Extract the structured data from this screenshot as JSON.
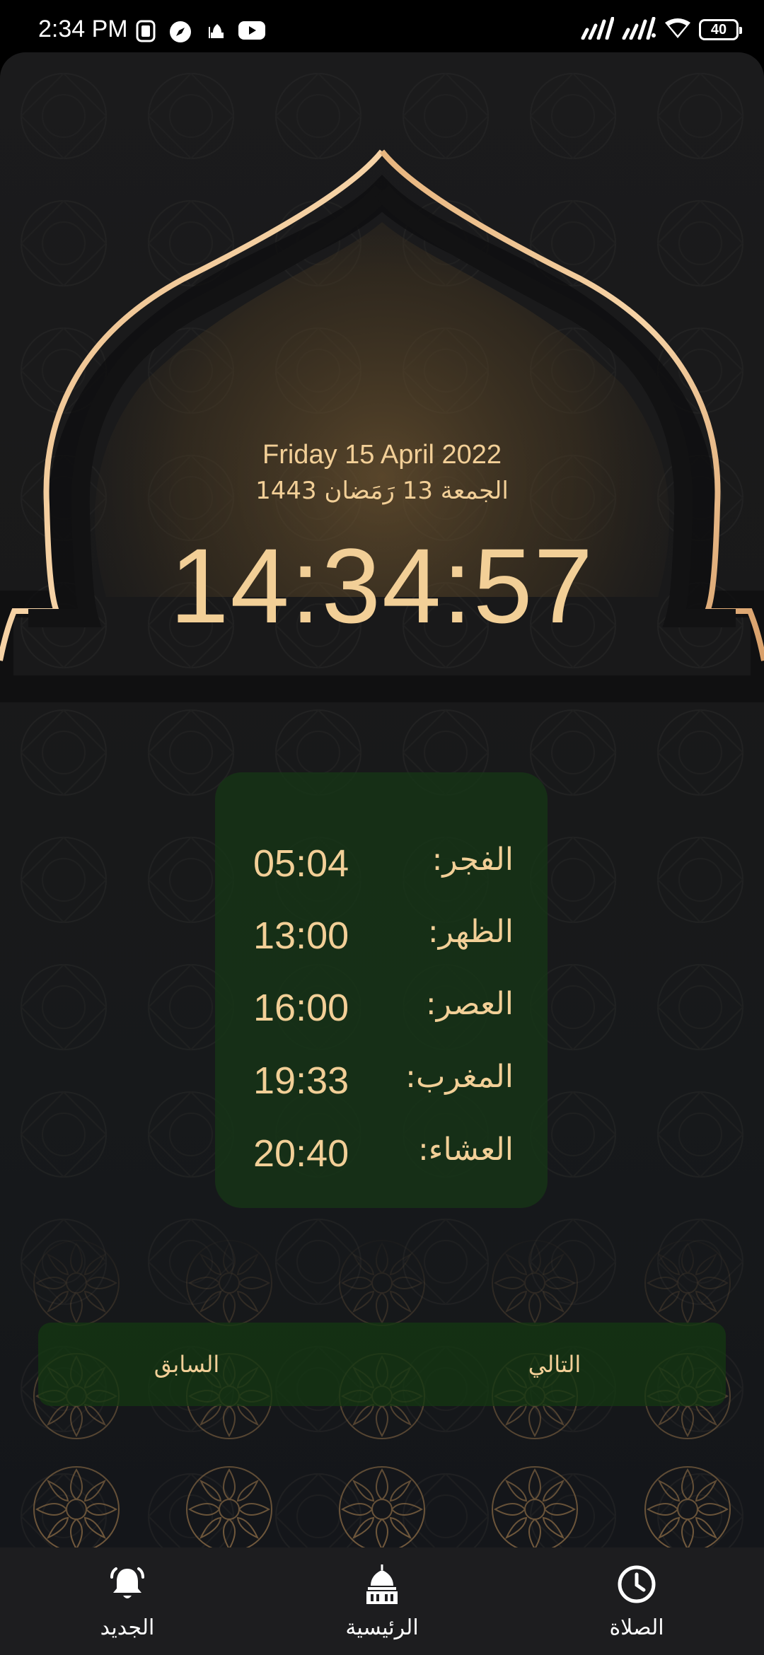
{
  "status_bar": {
    "time": "2:34 PM",
    "battery": "40",
    "icons": [
      "screen-record-icon",
      "compass-icon",
      "mosque-icon",
      "youtube-icon",
      "signal-icon",
      "signal-icon",
      "wifi-icon",
      "battery-icon"
    ]
  },
  "header": {
    "gregorian_date": "Friday 15 April 2022",
    "hijri_date": "الجمعة 13 رَمَضان 1443",
    "clock": "14:34:57"
  },
  "prayers": [
    {
      "name": "الفجر:",
      "time": "05:04"
    },
    {
      "name": "الظهر:",
      "time": "13:00"
    },
    {
      "name": "العصر:",
      "time": "16:00"
    },
    {
      "name": "المغرب:",
      "time": "19:33"
    },
    {
      "name": "العشاء:",
      "time": "20:40"
    }
  ],
  "day_nav": {
    "previous": "السابق",
    "next": "التالي"
  },
  "tabs": [
    {
      "label": "الجديد",
      "icon": "bell-icon"
    },
    {
      "label": "الرئيسية",
      "icon": "mosque-dome-icon"
    },
    {
      "label": "الصلاة",
      "icon": "clock-icon"
    }
  ],
  "colors": {
    "accent_gold": "#f2cf97",
    "card_green": "#163416",
    "background": "#1b1b1c"
  }
}
